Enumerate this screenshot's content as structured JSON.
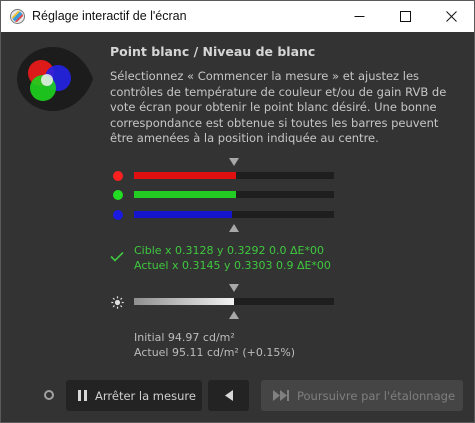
{
  "window": {
    "title": "Réglage interactif de l'écran",
    "controls": [
      "minimize-icon",
      "maximize-icon",
      "close-icon"
    ]
  },
  "header": {
    "title": "Point blanc / Niveau de blanc",
    "description": "Sélectionnez « Commencer la mesure » et ajustez les contrôles de température de couleur et/ou de gain RVB de vote écran pour obtenir le point blanc désiré. Une bonne correspondance est obtenue si toutes les barres peuvent être amenées à la position indiquée au centre."
  },
  "rgb_bars": [
    {
      "channel": "red",
      "color": "#e01010",
      "dot_color": "#ff2020",
      "fill": 0.51
    },
    {
      "channel": "green",
      "color": "#22cc22",
      "dot_color": "#22dd22",
      "fill": 0.51
    },
    {
      "channel": "blue",
      "color": "#1515cc",
      "dot_color": "#1a1ae0",
      "fill": 0.49
    }
  ],
  "measurement": {
    "cible": "Cible x 0.3128 y 0.3292 0.0 ΔE*00",
    "actuel": "Actuel x 0.3145 y 0.3303 0.9 ΔE*00",
    "status_color": "#3fc83f"
  },
  "luminance": {
    "fill": 0.5,
    "initial": "Initial 94.97 cd/m²",
    "actuel": "Actuel 95.11 cd/m² (+0.15%)"
  },
  "footer": {
    "stop_label": "Arrêter la mesure",
    "stop_icon": "pause-icon",
    "back_icon": "back-triangle-icon",
    "next_label": "Poursuivre par l'étalonnage",
    "next_icon": "skip-forward-icon",
    "next_enabled": false
  }
}
